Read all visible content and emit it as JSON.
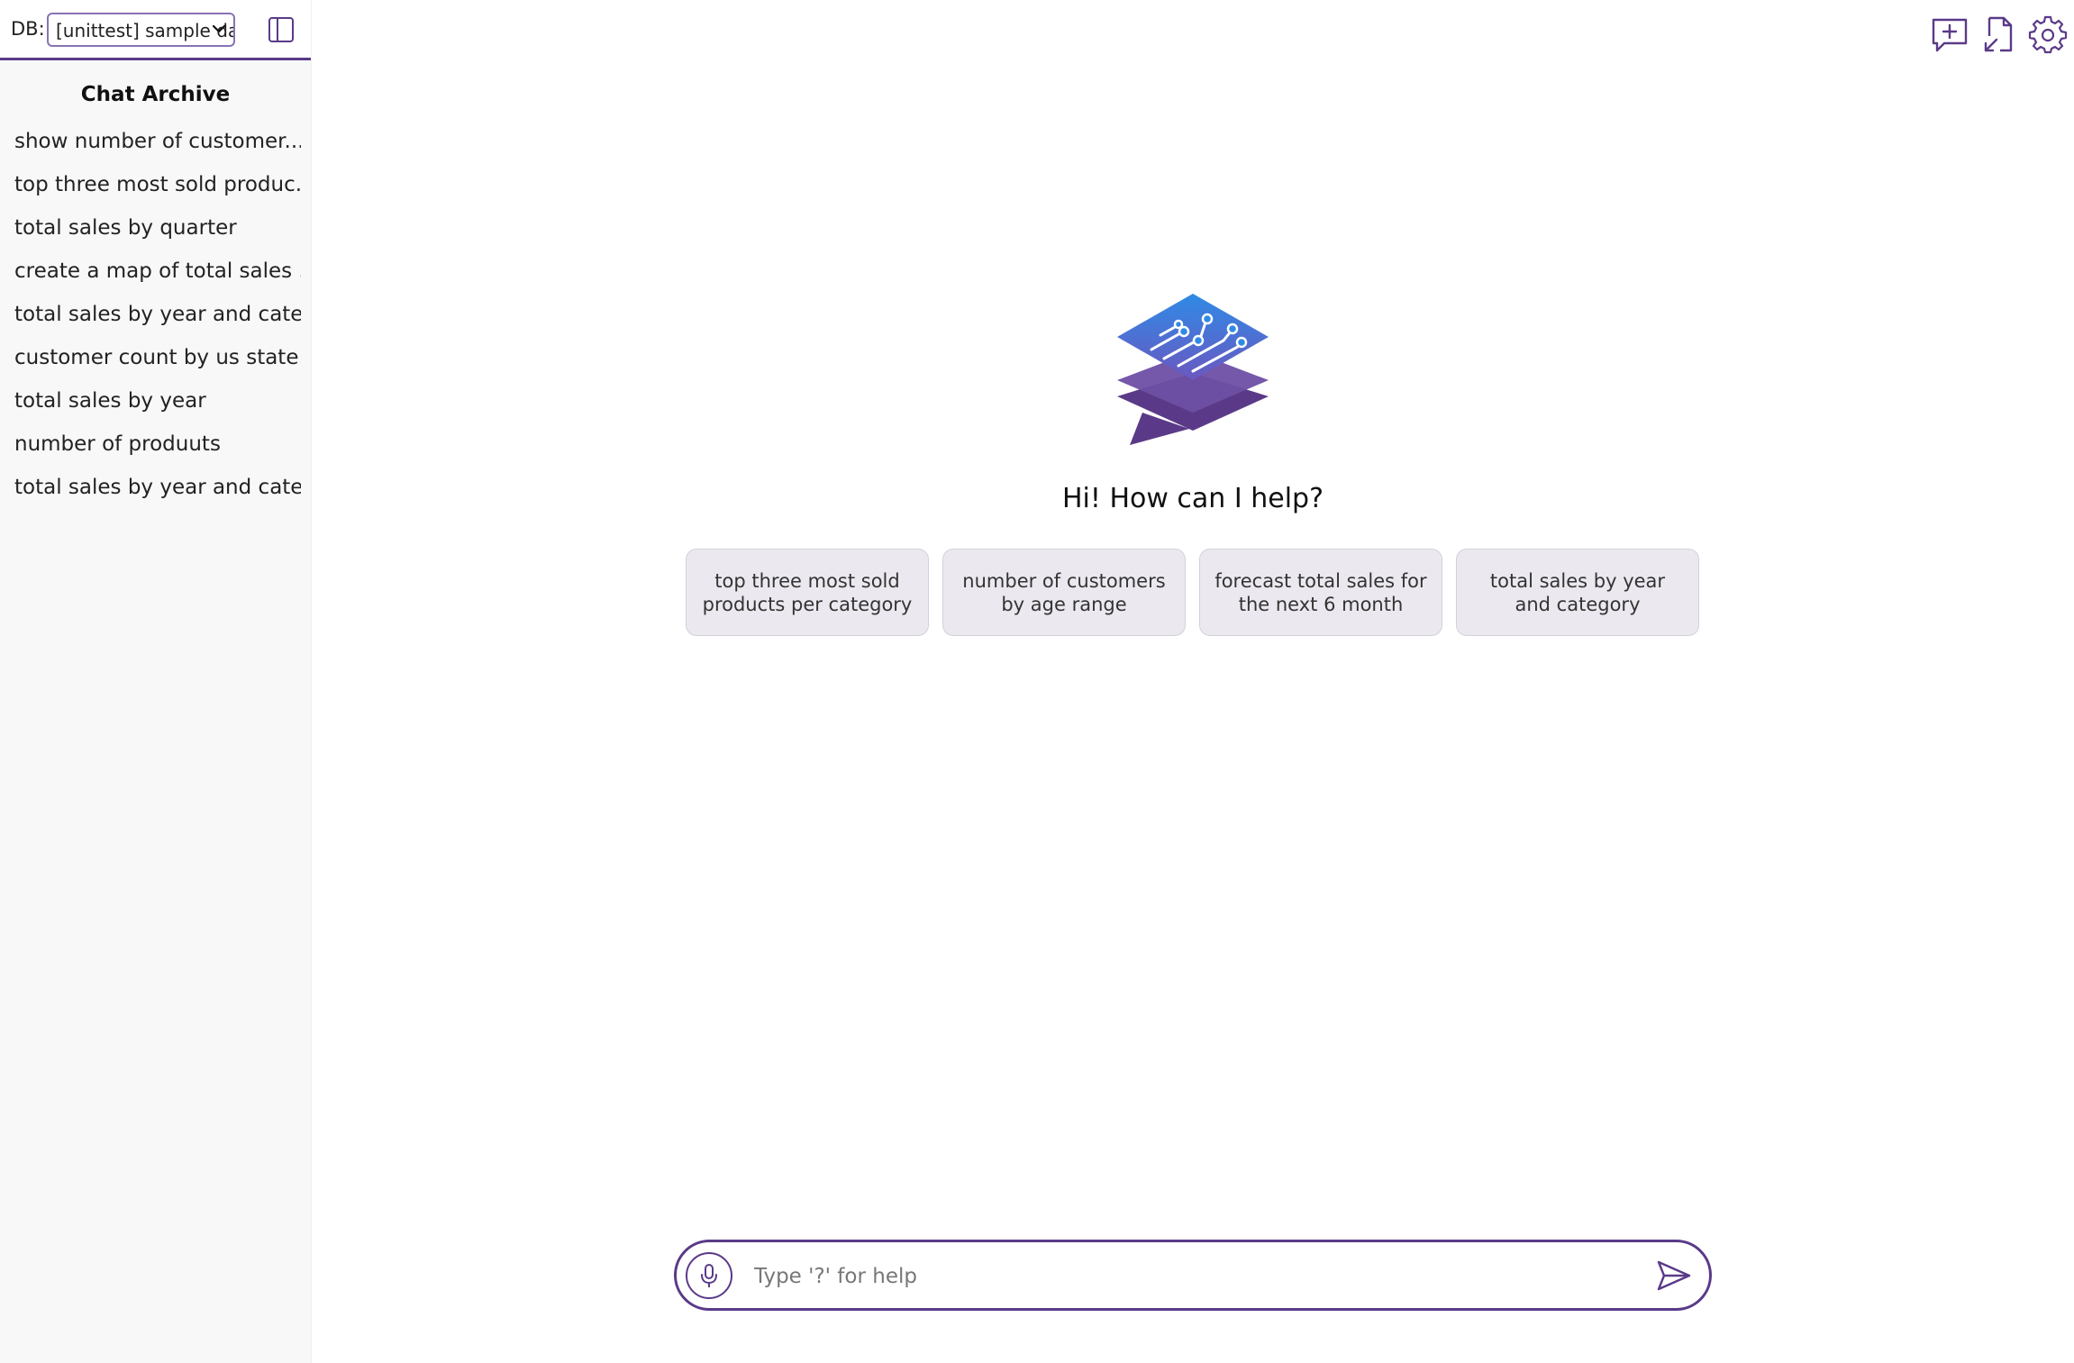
{
  "sidebar": {
    "db_label": "DB:",
    "db_selected": "[unittest] sample da",
    "archive_title": "Chat Archive",
    "archive_items": [
      {
        "label": "show number of customer..."
      },
      {
        "label": "top three most sold produc..."
      },
      {
        "label": "total sales by quarter"
      },
      {
        "label": "create a map of total sales ..."
      },
      {
        "label": "total sales by year and cate..."
      },
      {
        "label": "customer count by us state..."
      },
      {
        "label": "total sales by year"
      },
      {
        "label": "number of produuts"
      },
      {
        "label": "total sales by year and cate..."
      }
    ]
  },
  "header_icons": [
    "new-chat-icon",
    "export-document-icon",
    "settings-gear-icon"
  ],
  "main": {
    "greeting": "Hi! How can I help?",
    "suggestions": [
      {
        "label": "top three most sold products per category"
      },
      {
        "label": "number of customers by age range"
      },
      {
        "label": "forecast total sales for the next 6 month"
      },
      {
        "label": "total sales by year and category"
      }
    ]
  },
  "chat_input": {
    "placeholder": "Type '?' for help",
    "value": ""
  },
  "colors": {
    "accent": "#5a3a88",
    "chip_bg": "#ebe9ef",
    "sidebar_bg": "#f8f8f8",
    "logo_blue": "#2e7bdc",
    "logo_purple": "#5a3a88"
  }
}
